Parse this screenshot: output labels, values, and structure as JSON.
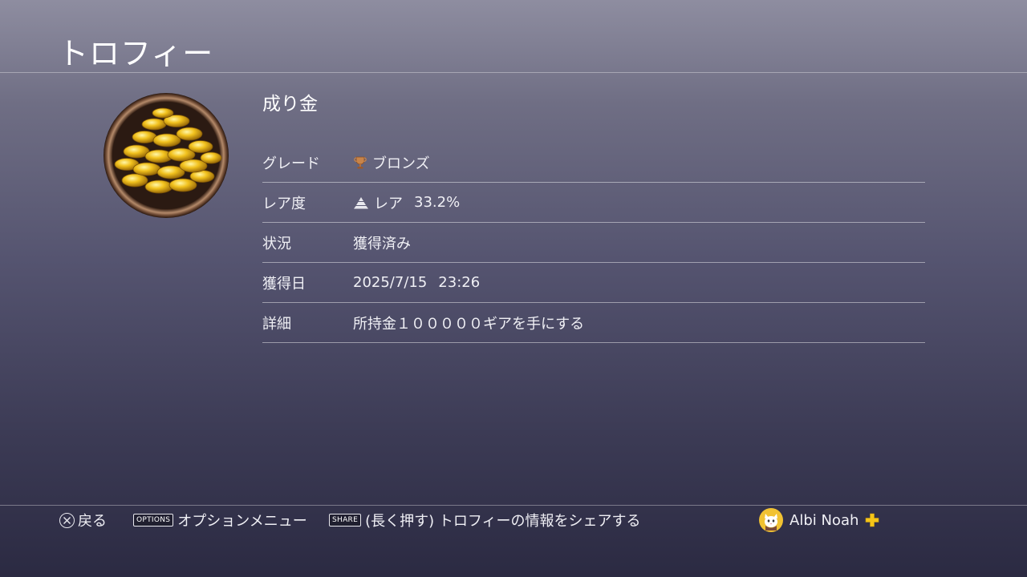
{
  "header": {
    "title": "トロフィー"
  },
  "trophy": {
    "name": "成り金",
    "icon": "gold-coins-pile-icon",
    "rows": [
      {
        "label": "グレード",
        "value": "ブロンズ",
        "icon": "bronze-trophy-icon"
      },
      {
        "label": "レア度",
        "value": "レア",
        "extra": "33.2%",
        "icon": "rarity-pyramid-icon"
      },
      {
        "label": "状況",
        "value": "獲得済み"
      },
      {
        "label": "獲得日",
        "value": "2025/7/15",
        "extra": "23:26"
      },
      {
        "label": "詳細",
        "value": "所持金１０００００ギアを手にする"
      }
    ]
  },
  "footer": {
    "back_label": "戻る",
    "options_chip": "OPTIONS",
    "options_label": "オプションメニュー",
    "share_chip": "SHARE",
    "share_label": "(長く押す) トロフィーの情報をシェアする",
    "user_name": "Albi Noah",
    "user_avatar": "cat-avatar-icon",
    "plus_icon": "ps-plus-icon"
  },
  "colors": {
    "bronze": "#c8844a",
    "plus_gold": "#f5c518",
    "avatar_bg": "#f1c232"
  }
}
